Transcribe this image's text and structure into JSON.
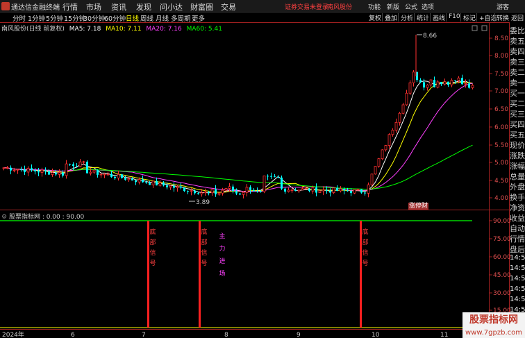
{
  "titlebar": {
    "app_title": "通达信金融终端",
    "menu": [
      "行情",
      "市场",
      "资讯",
      "发现",
      "问小达",
      "财富圈",
      "交易"
    ],
    "alert": "证券交易未登录",
    "stock_link": "南风股份",
    "right": [
      "功能",
      "新版",
      "公式",
      "选项",
      "游客"
    ]
  },
  "toolbar": {
    "periods": [
      "分时",
      "1分钟",
      "5分钟",
      "15分钟",
      "30分钟",
      "60分钟",
      "日线",
      "周线",
      "月线",
      "多周期",
      "更多"
    ],
    "active_period": "日线",
    "buttons": [
      "复权",
      "叠加",
      "分析",
      "统计",
      "画线",
      "F10",
      "标记",
      "+自选"
    ],
    "sub_buttons": [
      "转换",
      "返回"
    ]
  },
  "info_line": {
    "name": "南风股份(日线 前复权)",
    "ma5": "MA5: 7.18",
    "ma10": "MA10: 7.11",
    "ma20": "MA20: 7.16",
    "ma60": "MA60: 5.41"
  },
  "colors": {
    "ma5": "#ffffff",
    "ma10": "#ffff00",
    "ma20": "#ff40ff",
    "ma60": "#00ff00",
    "up": "#ff3030",
    "down": "#00ffff",
    "axis": "#e05050",
    "signal": "#ff2020"
  },
  "chart_data": {
    "type": "candlestick",
    "price_axis": [
      "8.50",
      "8.00",
      "7.50",
      "7.00",
      "6.50",
      "6.00",
      "5.50",
      "5.00",
      "4.50",
      "4.00"
    ],
    "high_label": "8.66",
    "low_label": "3.89",
    "x_labels": [
      "2024年",
      "6",
      "7",
      "8",
      "9",
      "10",
      "11"
    ],
    "indicator_axis": [
      "90.00",
      "75.00",
      "60.00",
      "45.00",
      "30.00",
      "15.00"
    ]
  },
  "indicator": {
    "title": "股票指标网 : 0.00 : 90.00",
    "signals": [
      {
        "text": [
          "底",
          "部",
          "信",
          "号"
        ]
      },
      {
        "text": [
          "底",
          "部",
          "信",
          "号"
        ]
      },
      {
        "text": [
          "主",
          "力",
          "进",
          "场"
        ]
      },
      {
        "text": [
          "底",
          "部",
          "信",
          "号"
        ]
      }
    ]
  },
  "badge": "涨停财",
  "right_panel": {
    "items": [
      "委比",
      "卖五",
      "卖四",
      "卖三",
      "卖二",
      "卖一",
      "买一",
      "买二",
      "买三",
      "买四",
      "买五",
      "现价",
      "涨跌",
      "涨幅",
      "总量",
      "外盘",
      "换手",
      "净资",
      "收益",
      "自动",
      "行情",
      "盘后"
    ],
    "times": [
      "14:50",
      "14:50",
      "14:50",
      "14:50",
      "14:50",
      "14:50",
      "14:50",
      "14:50"
    ]
  },
  "watermark": {
    "top": "股票指标网",
    "bottom": "www.7gpzb.com"
  }
}
